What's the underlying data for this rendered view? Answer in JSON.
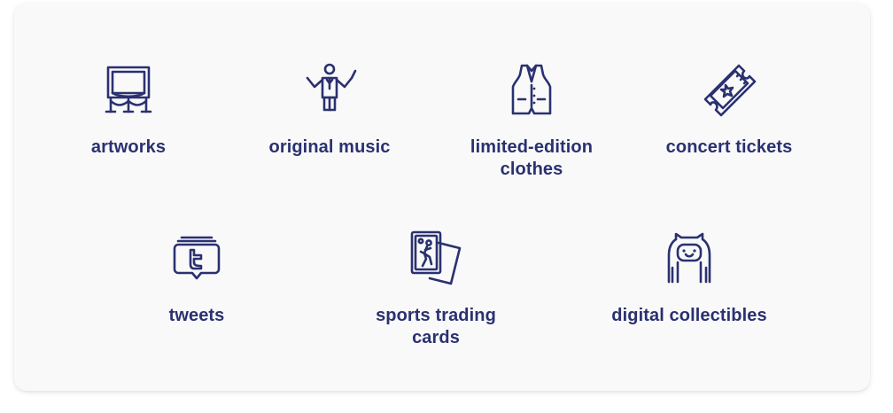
{
  "items": [
    {
      "label": "artworks",
      "icon": "gallery-icon"
    },
    {
      "label": "original music",
      "icon": "conductor-icon"
    },
    {
      "label": "limited-edition clothes",
      "icon": "vest-icon"
    },
    {
      "label": "concert tickets",
      "icon": "ticket-icon"
    },
    {
      "label": "tweets",
      "icon": "tweet-icon"
    },
    {
      "label": "sports trading cards",
      "icon": "trading-cards-icon"
    },
    {
      "label": "digital collectibles",
      "icon": "character-icon"
    }
  ],
  "colors": {
    "text": "#2a3170",
    "icon": "#2a3170",
    "card_background": "#f9f9fa"
  }
}
